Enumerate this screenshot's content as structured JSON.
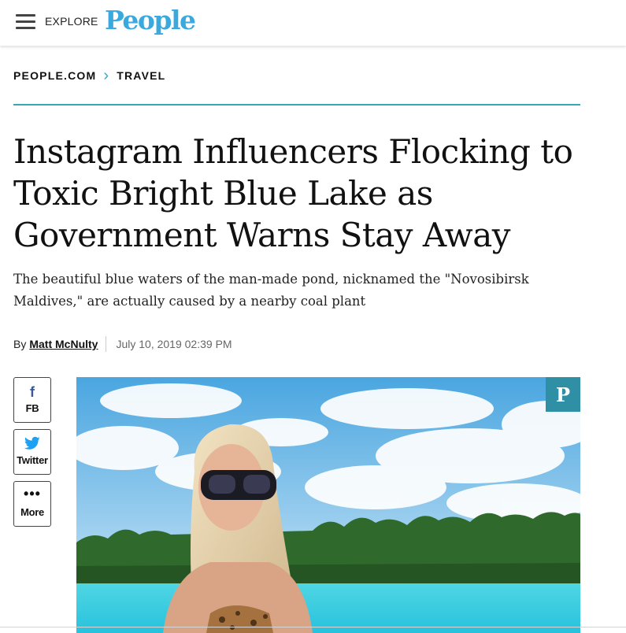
{
  "header": {
    "explore_label": "EXPLORE",
    "logo_text": "People",
    "logo_color": "#3aa9de"
  },
  "breadcrumb": {
    "items": [
      "PEOPLE.COM",
      "TRAVEL"
    ],
    "separator_icon": "chevron-right-icon",
    "accent_color": "#36a8b0"
  },
  "article": {
    "headline_lines": [
      "Instagram Influencers Flocking to",
      "Toxic Bright Blue Lake as",
      "Government Warns Stay Away"
    ],
    "dek_lines": [
      "The beautiful blue waters of the man-made pond, nicknamed the \"Novosibirsk",
      "Maldives,\" are actually caused by a nearby coal plant"
    ],
    "byline_prefix": "By",
    "author": "Matt McNulty",
    "date": "July 10, 2019 02:39 PM"
  },
  "share": {
    "fb_label": "FB",
    "twitter_label": "Twitter",
    "more_label": "More",
    "fb_icon": "facebook-icon",
    "twitter_icon": "twitter-icon",
    "more_icon": "ellipsis-icon"
  },
  "hero": {
    "pin_icon": "pinterest-icon",
    "pin_color": "#2f8fa5"
  }
}
